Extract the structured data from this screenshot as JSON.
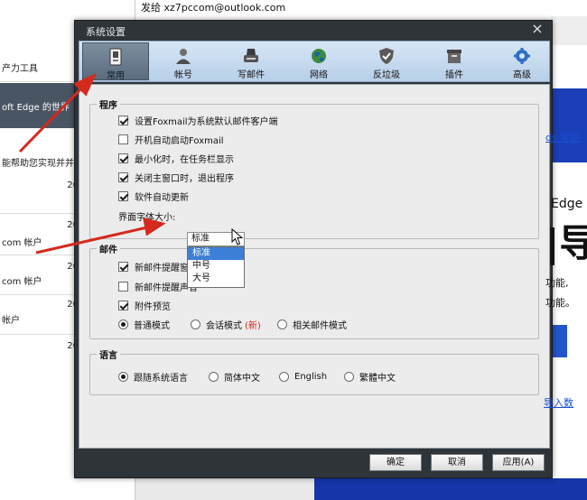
{
  "background": {
    "top_text": "发给 xz7pccom@outlook.com",
    "left_items": [
      "产力工具",
      "oft Edge 的世界",
      "能帮助您实现并并",
      "com 帐户",
      "com 帐户",
      "帐户"
    ],
    "left_dates": [
      "20",
      "20",
      "20",
      "20",
      "20"
    ],
    "right_texts": [
      "ds 奖励",
      "Edge",
      "功能,",
      "功能。",
      "导入数"
    ],
    "big_glyph": "|导"
  },
  "dialog": {
    "title": "系统设置",
    "close_glyph": "×",
    "tabs": [
      {
        "label": "常用",
        "icon": "general-icon",
        "active": true
      },
      {
        "label": "帐号",
        "icon": "account-icon",
        "active": false
      },
      {
        "label": "写邮件",
        "icon": "compose-icon",
        "active": false
      },
      {
        "label": "网络",
        "icon": "network-icon",
        "active": false
      },
      {
        "label": "反垃圾",
        "icon": "antispam-icon",
        "active": false
      },
      {
        "label": "插件",
        "icon": "plugin-icon",
        "active": false
      },
      {
        "label": "高级",
        "icon": "advanced-icon",
        "active": false
      }
    ],
    "program": {
      "title": "程序",
      "options": [
        {
          "label": "设置Foxmail为系统默认邮件客户端",
          "checked": true
        },
        {
          "label": "开机自动启动Foxmail",
          "checked": false
        },
        {
          "label": "最小化时，在任务栏显示",
          "checked": true
        },
        {
          "label": "关闭主窗口时，退出程序",
          "checked": true
        },
        {
          "label": "软件自动更新",
          "checked": true
        }
      ],
      "font_size_label": "界面字体大小:",
      "font_size_value": "标准",
      "font_size_options": [
        "标准",
        "中号",
        "大号"
      ]
    },
    "mail": {
      "title": "邮件",
      "options": [
        {
          "label": "新邮件提醒窗口",
          "checked": true
        },
        {
          "label": "新邮件提醒声音",
          "checked": false
        },
        {
          "label": "附件预览",
          "checked": true
        }
      ],
      "modes": [
        {
          "label": "普通模式",
          "selected": true
        },
        {
          "label": "会话模式",
          "selected": false,
          "tag": "(新)"
        },
        {
          "label": "相关邮件模式",
          "selected": false
        }
      ]
    },
    "language": {
      "title": "语言",
      "options": [
        {
          "label": "跟随系统语言",
          "selected": true
        },
        {
          "label": "简体中文",
          "selected": false
        },
        {
          "label": "English",
          "selected": false
        },
        {
          "label": "繁體中文",
          "selected": false
        }
      ]
    },
    "buttons": {
      "ok": "确定",
      "cancel": "取消",
      "apply": "应用(A)"
    }
  },
  "colors": {
    "annotation_arrow": "#d42a1e",
    "highlight": "#3c7fd6",
    "dialog_frame": "#2f3439"
  }
}
